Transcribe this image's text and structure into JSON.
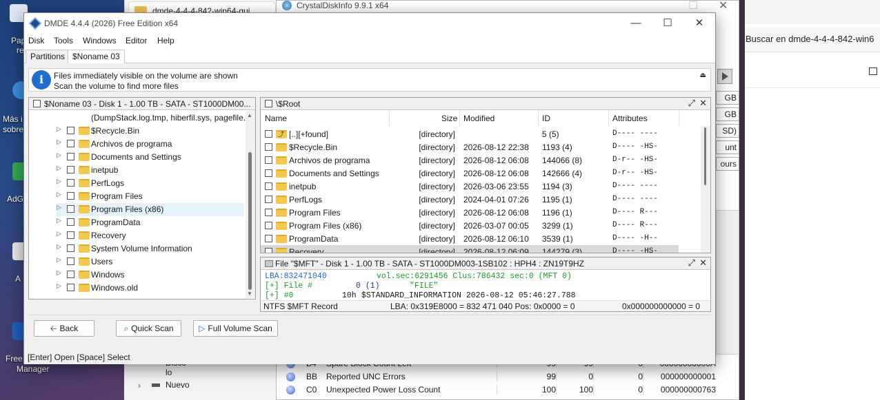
{
  "desktop": {
    "icons": [
      "Pap",
      "re",
      "Más i",
      "sobre",
      "AdG",
      "A",
      "Free",
      "Manager"
    ]
  },
  "explorer_tab": {
    "title": "dmde-4-4-4-842-win64-gui"
  },
  "crystal": {
    "title": "CrystalDiskInfo 9.9.1 x64",
    "right_fields": [
      "GB",
      "GB",
      "SD)",
      "unt",
      "ours"
    ],
    "rows": [
      {
        "id": "B4",
        "name": "Spare Block Count Left",
        "current": "99",
        "worst": "99",
        "threshold": "0",
        "raw": "00000000000A"
      },
      {
        "id": "BB",
        "name": "Reported UNC Errors",
        "current": "99",
        "worst": "0",
        "threshold": "0",
        "raw": "000000000001"
      },
      {
        "id": "C0",
        "name": "Unexpected Power Loss Count",
        "current": "100",
        "worst": "100",
        "threshold": "0",
        "raw": "000000000763"
      }
    ],
    "side_tree": [
      "Disco lo",
      "Nuevo"
    ]
  },
  "right_window": {
    "search_text": "Buscar en dmde-4-4-4-842-win6"
  },
  "window": {
    "title": "DMDE 4.4.4 (2026) Free Edition x64",
    "controls": {
      "minimize": "—",
      "maximize": "☐",
      "close": "✕"
    }
  },
  "menu": [
    "Disk",
    "Tools",
    "Windows",
    "Editor",
    "Help"
  ],
  "tabs": [
    "Partitions",
    "$Noname 03"
  ],
  "info": {
    "line1": "Files immediately visible on the volume are shown",
    "line2": "Scan the volume to find more files"
  },
  "tree_panel": {
    "title": "$Noname 03 - Disk 1 - 1.00 TB - SATA - ST1000DM00...",
    "first_item": "(DumpStack.log.tmp, hiberfil.sys, pagefile.",
    "items": [
      "$Recycle.Bin",
      "Archivos de programa",
      "Documents and Settings",
      "inetpub",
      "PerfLogs",
      "Program Files",
      "Program Files (x86)",
      "ProgramData",
      "Recovery",
      "System Volume Information",
      "Users",
      "Windows",
      "Windows.old"
    ]
  },
  "list_panel": {
    "title": "\\$Root",
    "headers": {
      "name": "Name",
      "size": "Size",
      "modified": "Modified",
      "id": "ID",
      "attributes": "Attributes"
    },
    "rows": [
      {
        "name": "[..][+found]",
        "size": "[directory]",
        "modified": "",
        "id": "5 (5)",
        "attr": "D---- ----"
      },
      {
        "name": "$Recycle.Bin",
        "size": "[directory]",
        "modified": "2026-08-12 22:38",
        "id": "1193 (4)",
        "attr": "D---- -HS-"
      },
      {
        "name": "Archivos de programa",
        "size": "[directory]",
        "modified": "2026-08-12 06:08",
        "id": "144066 (8)",
        "attr": "D-r-- -HS-"
      },
      {
        "name": "Documents and Settings",
        "size": "[directory]",
        "modified": "2026-08-12 06:08",
        "id": "142666 (4)",
        "attr": "D-r-- -HS-"
      },
      {
        "name": "inetpub",
        "size": "[directory]",
        "modified": "2026-03-06 23:55",
        "id": "1194 (3)",
        "attr": "D---- ----"
      },
      {
        "name": "PerfLogs",
        "size": "[directory]",
        "modified": "2024-04-01 07:26",
        "id": "1195 (1)",
        "attr": "D---- ----"
      },
      {
        "name": "Program Files",
        "size": "[directory]",
        "modified": "2026-08-12 06:08",
        "id": "1196 (1)",
        "attr": "D---- R---"
      },
      {
        "name": "Program Files (x86)",
        "size": "[directory]",
        "modified": "2026-03-07 00:05",
        "id": "3299 (1)",
        "attr": "D---- R---"
      },
      {
        "name": "ProgramData",
        "size": "[directory]",
        "modified": "2026-08-12 06:10",
        "id": "3539 (1)",
        "attr": "D---- -H--"
      },
      {
        "name": "Recovery",
        "size": "[directory]",
        "modified": "2026-08-12 06:09",
        "id": "144279 (3)",
        "attr": "D---- -HS-"
      }
    ]
  },
  "mft_panel": {
    "title": "File \"$MFT\" - Disk 1 - 1.00 TB - SATA - ST1000DM003-1SB102 : HPH4 : ZN19T9HZ",
    "line1_left": "LBA:832471040",
    "line1_right": "vol.sec:6291456 Clus:786432 sec:0 (MFT 0)",
    "line2_a": "[+] File #",
    "line2_b": "0 (1)",
    "line2_c": "\"FILE\"",
    "line3_a": "[+] #0",
    "line3_b": "10h",
    "line3_c": "$STANDARD_INFORMATION 2026-08-12 05:46:27.788",
    "status_left": "NTFS $MFT Record",
    "status_mid": "LBA: 0x319E8000 = 832 471 040  Pos: 0x0000 = 0",
    "status_right": "0x000000000000 = 0"
  },
  "buttons": {
    "back": "Back",
    "quick_scan": "Quick Scan",
    "full_scan": "Full Volume Scan"
  },
  "statusbar": "[Enter] Open  [Space] Select"
}
